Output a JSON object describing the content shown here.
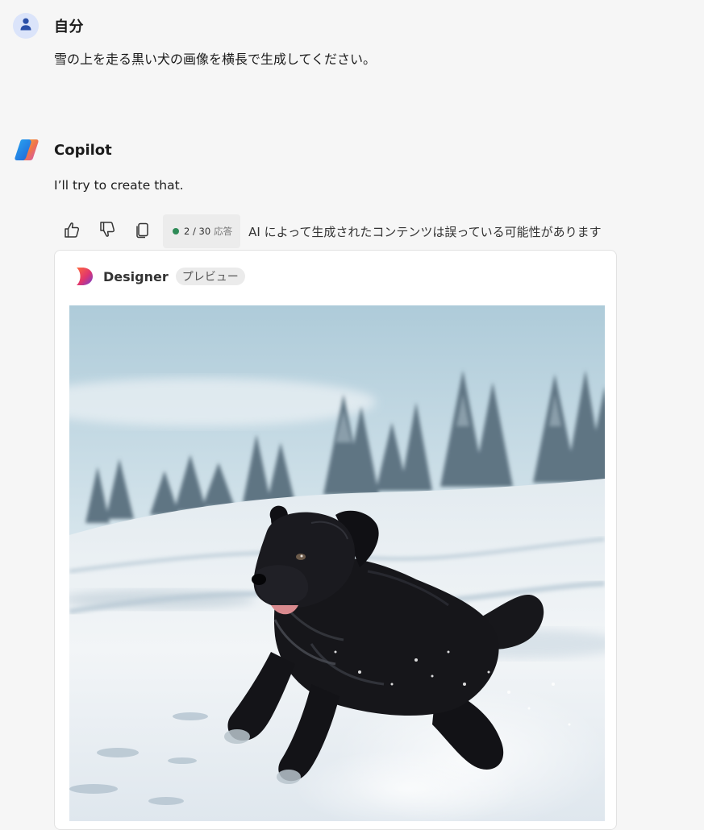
{
  "user": {
    "name": "自分",
    "message": "雪の上を走る黒い犬の画像を横長で生成してください。"
  },
  "copilot": {
    "name": "Copilot",
    "message": "I’ll try to create that."
  },
  "toolbar": {
    "like_icon": "thumbs-up-icon",
    "dislike_icon": "thumbs-down-icon",
    "copy_icon": "copy-icon",
    "counter": "2 / 30",
    "counter_suffix": "応答",
    "counter_color": "#2e8b57",
    "disclaimer": "AI によって生成されたコンテンツは誤っている可能性があります"
  },
  "designer": {
    "name": "Designer",
    "badge": "プレビュー",
    "image_subject": "black dog running on snow"
  },
  "colors": {
    "background": "#f6f6f6",
    "user_avatar_bg": "#dbe4fa",
    "user_avatar_fg": "#2a4fa8"
  }
}
